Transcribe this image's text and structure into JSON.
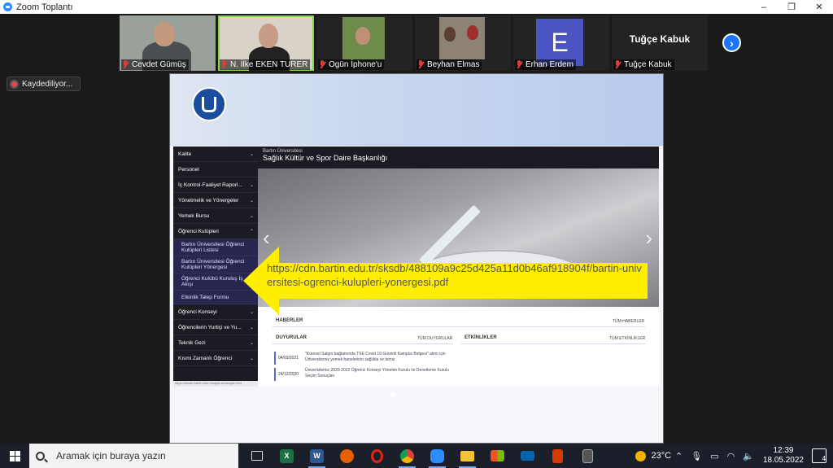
{
  "window": {
    "title": "Zoom Toplantı",
    "controls": [
      "–",
      "❐",
      "✕"
    ]
  },
  "participants": [
    {
      "name": "Cevdet Gümüş",
      "muted": true,
      "kind": "video"
    },
    {
      "name": "N. İlke EKEN TURER",
      "muted": true,
      "kind": "video",
      "active": true
    },
    {
      "name": "Ogün İphone'u",
      "muted": true,
      "kind": "video"
    },
    {
      "name": "Beyhan Elmas",
      "muted": true,
      "kind": "video"
    },
    {
      "name": "Erhan Erdem",
      "muted": true,
      "kind": "avatar",
      "initial": "E"
    },
    {
      "name": "Tuğçe Kabuk",
      "muted": true,
      "kind": "name-only",
      "display": "Tuğçe Kabuk"
    }
  ],
  "recording": {
    "label": "Kaydediliyor..."
  },
  "website": {
    "header_small": "Bartın Üniversitesi",
    "header_title": "Sağlık Kültür ve Spor Daire Başkanlığı",
    "nav": [
      {
        "label": "Kalite",
        "chev": "⌄"
      },
      {
        "label": "Personel",
        "chev": ""
      },
      {
        "label": "İç Kontrol-Faaliyet Raporl...",
        "chev": "⌄"
      },
      {
        "label": "Yönetmelik ve Yönergeler",
        "chev": "⌄"
      },
      {
        "label": "Yemek Bursu",
        "chev": "⌄"
      },
      {
        "label": "Öğrenci Kulüpleri",
        "chev": "⌃"
      }
    ],
    "subnav": [
      "Bartın Üniversitesi Öğrenci Kulüpleri Listesi",
      "Bartın Üniversitesi Öğrenci Kulüpleri Yönergesi",
      "Öğrenci Kulübü Kuruluş İş Akışı",
      "Etkinlik Talep Formu"
    ],
    "nav2": [
      {
        "label": "Öğrenci Konseyi",
        "chev": "⌄"
      },
      {
        "label": "Öğrencilerin Yurtiçi ve Yu...",
        "chev": "⌄"
      },
      {
        "label": "Teknik Gezi",
        "chev": "⌄"
      },
      {
        "label": "Kısmi Zamanlı Öğrenci",
        "chev": "⌄"
      }
    ],
    "status_url": "https://sksdb.bartin.edu.tr/sayfa-anasayfa.html",
    "haberler": "HABERLER",
    "tum_haberler": "TÜM HABERLER",
    "duyurular": "DUYURULAR",
    "tum_duyurular": "TÜM DUYURULAR",
    "etkinlikler": "ETKİNLİKLER",
    "tum_etkinlikler": "TÜM ETKİNLİKLER",
    "announcements": [
      {
        "date": "04/03/2021",
        "text": "\"Küresel Salgın bağlamında TSE Covid 19 Güvenli Kampüs Belgesi\" alımı için Üniversitemiz yemek hanelerinin sağlıkla ve temiz"
      },
      {
        "date": "24/12/2020",
        "text": "Üniversitemiz 2020-2022 Öğrenci Konseyi Yönetim Kurulu ve Denetleme Kurulu Seçim Sonuçları"
      }
    ]
  },
  "callout": {
    "url": "https://cdn.bartin.edu.tr/sksdb/488109a9c25d425a11d0b46af918904f/bartin-universitesi-ogrenci-kulupleri-yonergesi.pdf",
    "color": "#ffee00"
  },
  "taskbar": {
    "search_placeholder": "Aramak için buraya yazın",
    "apps": [
      "task-view",
      "excel",
      "word",
      "firefox",
      "opera",
      "chrome",
      "zoom",
      "file-explorer",
      "store",
      "mail",
      "office",
      "calculator"
    ],
    "temperature": "23°C",
    "time": "12:39",
    "date": "18.05.2022",
    "notifications": "4"
  }
}
